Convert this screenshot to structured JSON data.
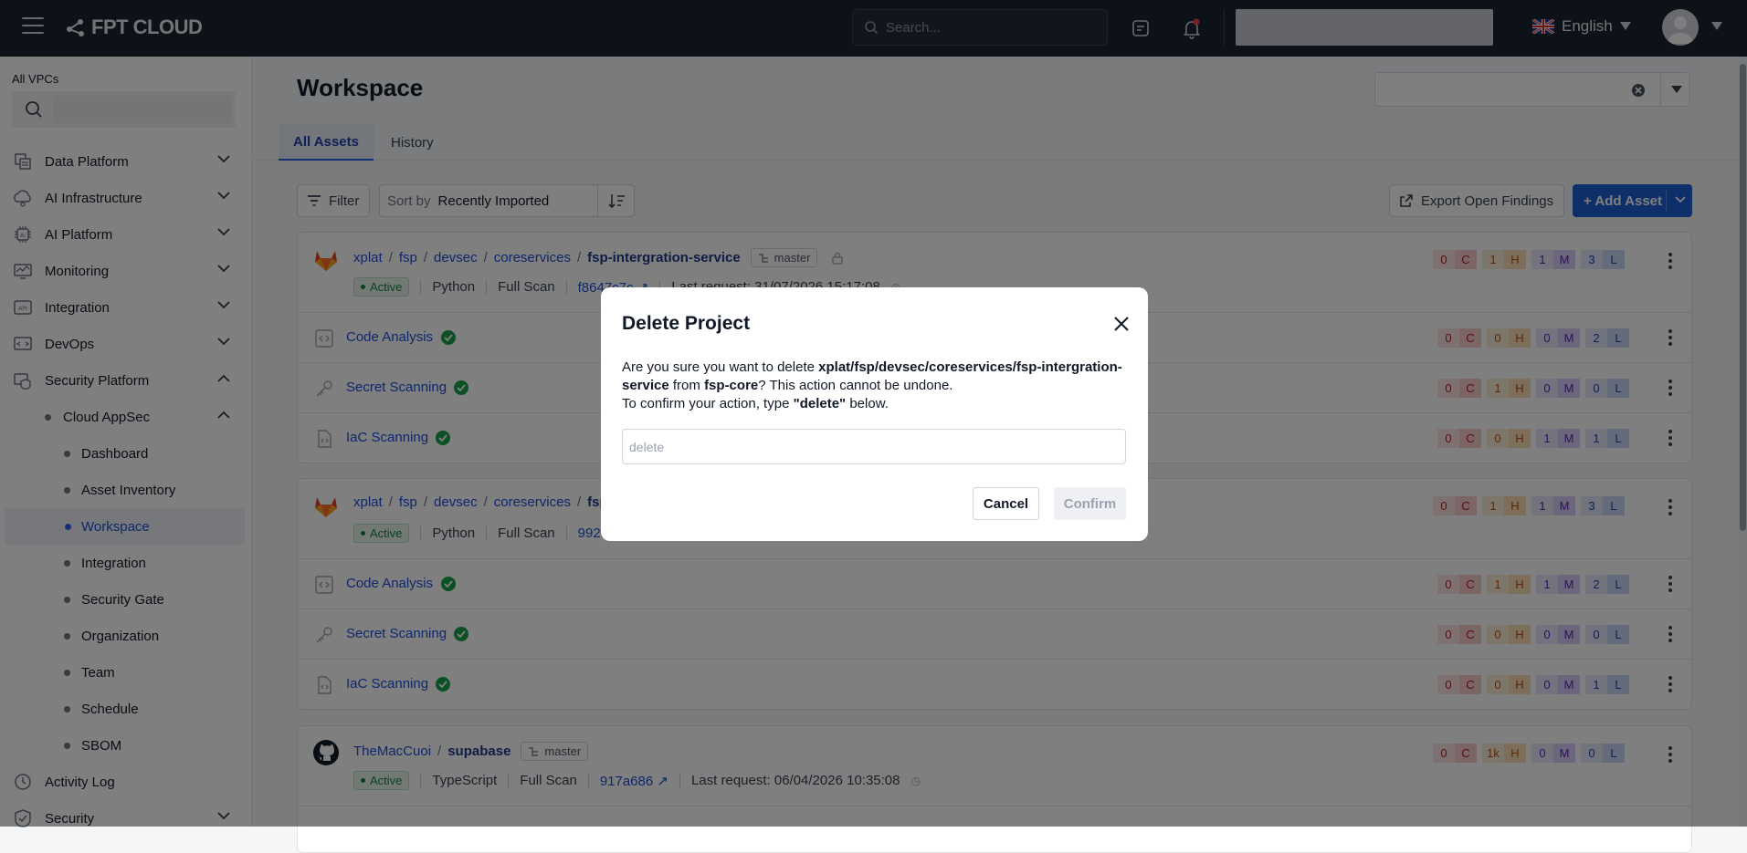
{
  "topbar": {
    "logo_text": "FPT CLOUD",
    "search_placeholder": "Search...",
    "language": "English",
    "icons": [
      "menu-icon",
      "logo-icon",
      "search-icon",
      "tasks-icon",
      "bell-icon",
      "flag-uk-icon",
      "avatar-icon",
      "caret-down-icon"
    ]
  },
  "sidebar": {
    "vpc_label": "All VPCs",
    "items": [
      {
        "label": "Data Platform",
        "icon": "database-icon"
      },
      {
        "label": "AI Infrastructure",
        "icon": "ai-infra-icon"
      },
      {
        "label": "AI Platform",
        "icon": "chip-icon"
      },
      {
        "label": "Monitoring",
        "icon": "monitor-icon"
      },
      {
        "label": "Integration",
        "icon": "api-icon"
      },
      {
        "label": "DevOps",
        "icon": "devops-icon"
      },
      {
        "label": "Security Platform",
        "icon": "security-platform-icon"
      }
    ],
    "cloud_appsec": "Cloud AppSec",
    "sub_items": [
      "Dashboard",
      "Asset Inventory",
      "Workspace",
      "Integration",
      "Security Gate",
      "Organization",
      "Team",
      "Schedule",
      "SBOM"
    ],
    "activity_log": "Activity Log",
    "security": "Security"
  },
  "main": {
    "title": "Workspace",
    "tabs": [
      "All Assets",
      "History"
    ],
    "filter_label": "Filter",
    "sort_prefix": "Sort by",
    "sort_value": "Recently Imported",
    "export_label": "Export Open Findings",
    "add_asset_label": "+ Add Asset"
  },
  "projects": [
    {
      "path": [
        "xplat",
        "fsp",
        "devsec",
        "coreservices"
      ],
      "name": "fsp-intergration-service",
      "branch": "master",
      "status": "Active",
      "language": "Python",
      "scan_type": "Full Scan",
      "commit": "f8647c7c",
      "last_request": "Last request: 31/07/2026 15:17:08",
      "counts": {
        "c": "0",
        "h": "1",
        "m": "1",
        "l": "3"
      },
      "scans": [
        {
          "name": "Code Analysis",
          "counts": {
            "c": "0",
            "h": "0",
            "m": "0",
            "l": "2"
          }
        },
        {
          "name": "Secret Scanning",
          "counts": {
            "c": "0",
            "h": "1",
            "m": "0",
            "l": "0"
          }
        },
        {
          "name": "IaC Scanning",
          "counts": {
            "c": "0",
            "h": "0",
            "m": "1",
            "l": "1"
          }
        }
      ]
    },
    {
      "path": [
        "xplat",
        "fsp",
        "devsec",
        "coreservices"
      ],
      "name": "fsp-c",
      "status": "Active",
      "language": "Python",
      "scan_type": "Full Scan",
      "commit": "992",
      "counts": {
        "c": "0",
        "h": "1",
        "m": "1",
        "l": "3"
      },
      "scans": [
        {
          "name": "Code Analysis",
          "counts": {
            "c": "0",
            "h": "1",
            "m": "1",
            "l": "2"
          }
        },
        {
          "name": "Secret Scanning",
          "counts": {
            "c": "0",
            "h": "0",
            "m": "0",
            "l": "0"
          }
        },
        {
          "name": "IaC Scanning",
          "counts": {
            "c": "0",
            "h": "0",
            "m": "0",
            "l": "1"
          }
        }
      ]
    },
    {
      "path": [
        "TheMacCuoi"
      ],
      "name": "supabase",
      "branch": "master",
      "status": "Active",
      "language": "TypeScript",
      "scan_type": "Full Scan",
      "commit": "917a686",
      "last_request": "Last request: 06/04/2026 10:35:08",
      "counts": {
        "c": "0",
        "h": "1k",
        "m": "0",
        "l": "0"
      }
    }
  ],
  "severity_letters": {
    "c": "C",
    "h": "H",
    "m": "M",
    "l": "L"
  },
  "modal": {
    "title": "Delete Project",
    "line1_pre": "Are you sure you want to delete ",
    "line1_bold": "xplat/fsp/devsec/coreservices/fsp-intergration-service",
    "line1_mid": " from ",
    "line1_bold2": "fsp-core",
    "line1_post": "? This action cannot be undone.",
    "line2_pre": "To confirm your action, type ",
    "line2_bold": "\"delete\"",
    "line2_post": " below.",
    "input_placeholder": "delete",
    "cancel_label": "Cancel",
    "confirm_label": "Confirm"
  },
  "colors": {
    "topbar": "#1b2433",
    "primary": "#1e5fd6",
    "success": "#16a34a"
  }
}
